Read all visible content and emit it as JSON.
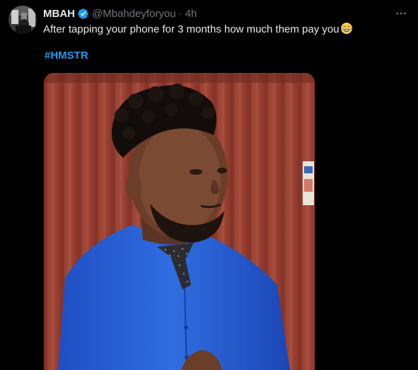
{
  "tweet": {
    "author_name": "MBAH",
    "handle": "@Mbahdeyforyou",
    "separator": "·",
    "time": "4h",
    "text": "After tapping your phone for 3 months how much them pay you",
    "emoji": "face-with-tears-of-joy-icon",
    "hashtag": "#HMSTR"
  },
  "colors": {
    "background": "#000000",
    "text_primary": "#e7e9ea",
    "text_secondary": "#71767b",
    "link": "#1d9bf0",
    "verified": "#1d9bf0"
  },
  "media": {
    "type": "video"
  }
}
